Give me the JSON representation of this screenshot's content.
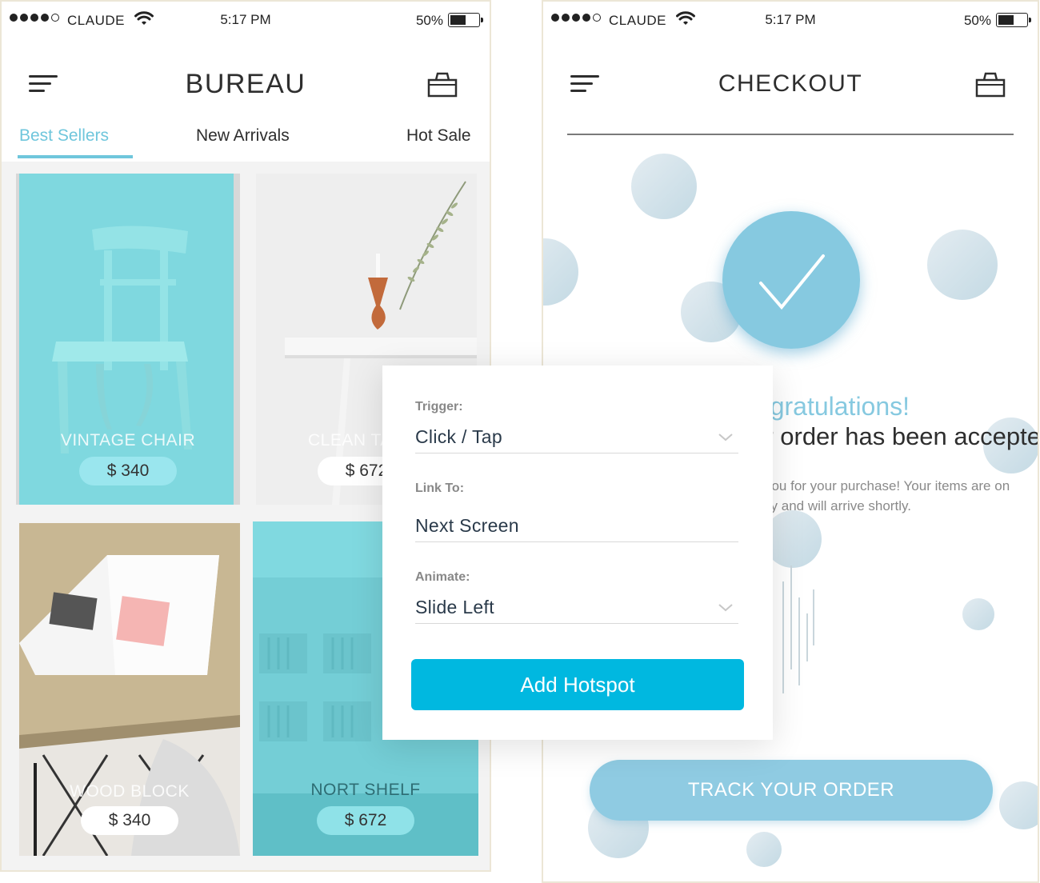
{
  "status_bar": {
    "carrier": "CLAUDE",
    "time": "5:17 PM",
    "battery": "50%"
  },
  "shop": {
    "title": "BUREAU",
    "tabs": [
      {
        "label": "Best Sellers",
        "active": true
      },
      {
        "label": "New Arrivals",
        "active": false
      },
      {
        "label": "Hot Sale",
        "active": false
      }
    ],
    "products": [
      {
        "name": "VINTAGE CHAIR",
        "price": "$ 340"
      },
      {
        "name": "CLEAN TABLE",
        "price": "$ 672"
      },
      {
        "name": "WOOD BLOCK",
        "price": "$ 340"
      },
      {
        "name": "NORT SHELF",
        "price": "$ 672"
      }
    ]
  },
  "checkout": {
    "title": "CHECKOUT",
    "heading": "Congratulations!",
    "subheading": "Your order has been accepted.",
    "body_line1": "Thank you for your purchase! Your items are on",
    "body_line2": "their way and will arrive shortly.",
    "track_button": "TRACK YOUR ORDER"
  },
  "hotspot_panel": {
    "trigger_label": "Trigger:",
    "trigger_value": "Click / Tap",
    "link_label": "Link To:",
    "link_value": "Next Screen",
    "animate_label": "Animate:",
    "animate_value": "Slide Left",
    "button": "Add Hotspot"
  },
  "colors": {
    "accent": "#6fc6dc",
    "teal_card": "#7fd8df",
    "checkout_blue": "#86c9e0",
    "button_blue": "#00b8e0"
  },
  "icons": [
    "signal-dots-icon",
    "wifi-icon",
    "battery-icon",
    "menu-icon",
    "shopping-bag-icon",
    "checkmark-icon",
    "chevron-down-icon"
  ]
}
